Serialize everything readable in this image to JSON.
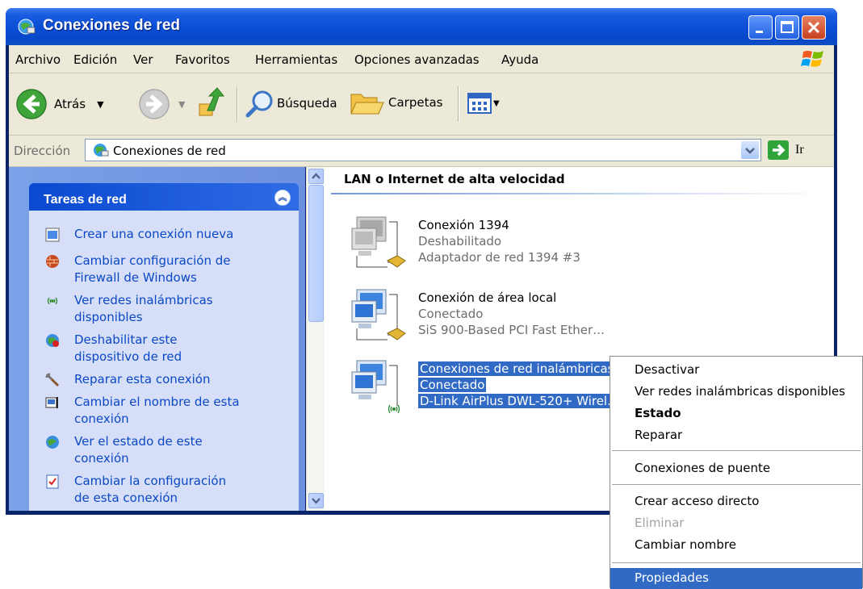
{
  "window": {
    "title": "Conexiones de red"
  },
  "menu": [
    "Archivo",
    "Edición",
    "Ver",
    "Favoritos",
    "Herramientas",
    "Opciones avanzadas",
    "Ayuda"
  ],
  "toolbar": {
    "back": "Atrás",
    "search": "Búsqueda",
    "folders": "Carpetas"
  },
  "address": {
    "label": "Dirección",
    "value": "Conexiones de red",
    "go": "Ir"
  },
  "tasks": {
    "title": "Tareas de red",
    "items": [
      {
        "label": "Crear una conexión nueva",
        "icon": "new-connection-icon"
      },
      {
        "label": "Cambiar configuración de Firewall de Windows",
        "icon": "firewall-icon"
      },
      {
        "label": "Ver redes inalámbricas disponibles",
        "icon": "wireless-icon"
      },
      {
        "label": "Deshabilitar este dispositivo de red",
        "icon": "disable-device-icon"
      },
      {
        "label": "Reparar esta conexión",
        "icon": "repair-icon"
      },
      {
        "label": "Cambiar el nombre de esta conexión",
        "icon": "rename-icon"
      },
      {
        "label": "Ver el estado de este conexión",
        "icon": "status-icon"
      },
      {
        "label": "Cambiar la configuración de esta conexión",
        "icon": "settings-icon"
      }
    ]
  },
  "group": {
    "title": "LAN o Internet de alta velocidad"
  },
  "connections": [
    {
      "name": "Conexión 1394",
      "status": "Deshabilitado",
      "device": "Adaptador de red 1394 #3",
      "enabled": false
    },
    {
      "name": "Conexión de área local",
      "status": "Conectado",
      "device": "SiS 900-Based PCI Fast Ether…",
      "enabled": true
    },
    {
      "name": "Conexiones de red inalámbricas",
      "status": "Conectado",
      "device": "D-Link AirPlus DWL-520+ Wirel…",
      "enabled": true,
      "selected": true
    }
  ],
  "context_menu": {
    "items": [
      {
        "label": "Desactivar"
      },
      {
        "label": "Ver redes inalámbricas disponibles"
      },
      {
        "label": "Estado",
        "bold": true
      },
      {
        "label": "Reparar"
      },
      {
        "label": "Conexiones de puente"
      },
      {
        "label": "Crear acceso directo"
      },
      {
        "label": "Eliminar",
        "disabled": true
      },
      {
        "label": "Cambiar nombre"
      },
      {
        "label": "Propiedades",
        "highlighted": true
      }
    ]
  },
  "colors": {
    "title_bar": "#0a4fd6",
    "task_link": "#0b48c6",
    "selection": "#316ac5",
    "task_pane": "#7ba1e7"
  }
}
